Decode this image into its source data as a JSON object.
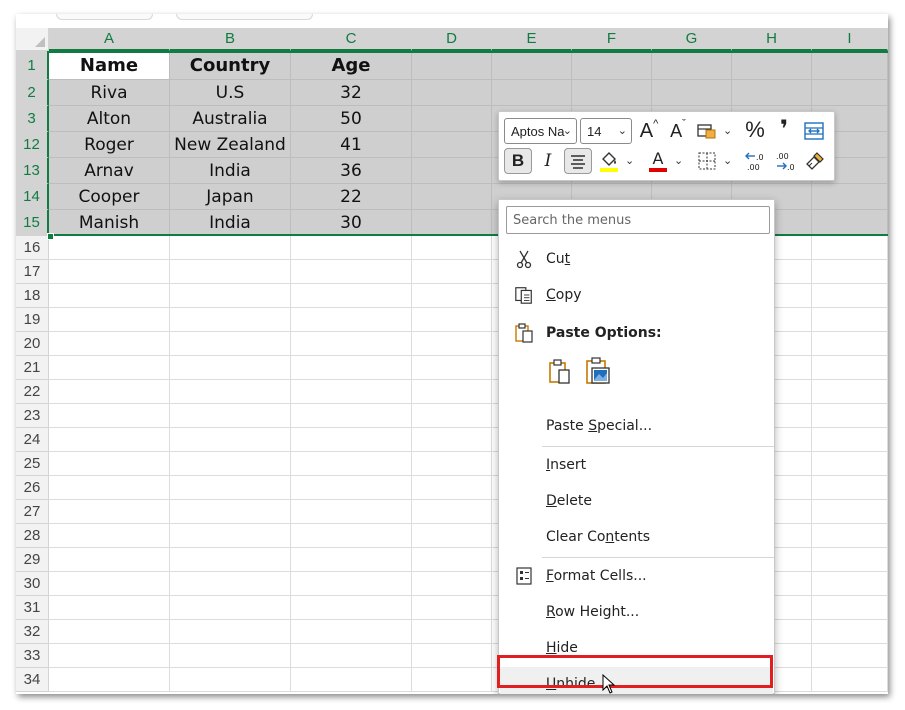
{
  "columns": [
    "A",
    "B",
    "C",
    "D",
    "E",
    "F",
    "G",
    "H",
    "I"
  ],
  "rows": [
    "1",
    "2",
    "3",
    "12",
    "13",
    "14",
    "15",
    "16",
    "17",
    "18",
    "19",
    "20",
    "21",
    "22",
    "23",
    "24",
    "25",
    "26",
    "27",
    "28",
    "29",
    "30",
    "31",
    "32",
    "33",
    "34"
  ],
  "table": {
    "headers": [
      "Name",
      "Country",
      "Age"
    ],
    "records": [
      [
        "Riva",
        "U.S",
        "32"
      ],
      [
        "Alton",
        "Australia",
        "50"
      ],
      [
        "Roger",
        "New Zealand",
        "41"
      ],
      [
        "Arnav",
        "India",
        "36"
      ],
      [
        "Cooper",
        "Japan",
        "22"
      ],
      [
        "Manish",
        "India",
        "30"
      ]
    ]
  },
  "mini_toolbar": {
    "font_name": "Aptos Na",
    "font_size": "14",
    "grow_font": "A",
    "shrink_font": "A",
    "percent": "%",
    "comma": "❜",
    "bold": "B",
    "italic": "I",
    "fill_color": "#ffff00",
    "font_color": "#e00000"
  },
  "context_menu": {
    "search_placeholder": "Search the menus",
    "cut": {
      "pre": "Cu",
      "u": "t",
      "post": ""
    },
    "copy": {
      "pre": "",
      "u": "C",
      "post": "opy"
    },
    "paste_options": "Paste Options:",
    "paste_special": {
      "pre": "Paste ",
      "u": "S",
      "post": "pecial..."
    },
    "insert": {
      "pre": "",
      "u": "I",
      "post": "nsert"
    },
    "delete": {
      "pre": "",
      "u": "D",
      "post": "elete"
    },
    "clear_contents": {
      "pre": "Clear Co",
      "u": "n",
      "post": "tents"
    },
    "format_cells": {
      "pre": "",
      "u": "F",
      "post": "ormat Cells..."
    },
    "row_height": {
      "pre": "",
      "u": "R",
      "post": "ow Height..."
    },
    "hide": {
      "pre": "",
      "u": "H",
      "post": "ide"
    },
    "unhide": {
      "pre": "",
      "u": "U",
      "post": "nhide"
    }
  },
  "colors": {
    "excel_green": "#107c41",
    "highlight_red": "#e02020",
    "selection_gray": "#cfcfcf"
  }
}
